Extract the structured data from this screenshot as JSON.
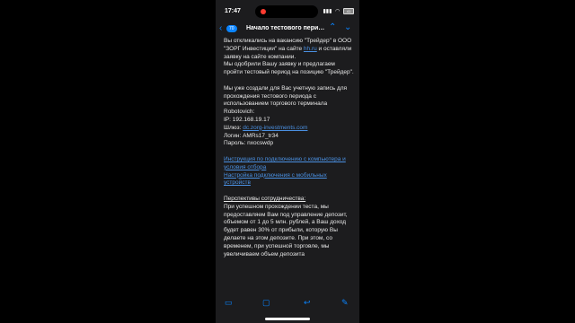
{
  "status": {
    "time": "17:47",
    "battery": "41"
  },
  "nav": {
    "back": "‹",
    "badge": "70",
    "title": "Начало тестового перио...",
    "up": "⌃",
    "down": "⌄"
  },
  "body": {
    "p1_a": "Вы откликались на вакансию \"Трейдер\" в ООО \"ЗОРГ Инвестиции\" на сайте ",
    "p1_link": "hh.ru",
    "p1_b": " и оставляли заявку на сайте компании.",
    "p1_c": "Мы одобрили Вашу заявку и предлагаем пройти тестовый период на позицию \"Трейдер\".",
    "p2": "Мы уже создали для Вас учетную запись для прохождения тестового периода с использованием торгового терминала Robotovich:",
    "ip": "IP: 192.168.19.17",
    "gateway_label": "Шлюз: ",
    "gateway_link": "dc.zorg-investments.com",
    "login": "Логин: AMRs17_tr34",
    "password": "Пароль: nxocswdp",
    "link1": "Инструкция по подключению с компьютера и условия отбора",
    "link2": "Настройка подключения с мобильных устройств",
    "perspectives_heading": "Перспективы сотрудничества:",
    "perspectives_text": "При успешном прохождении теста, мы предоставляем Вам под управление депозит, объемом от 1 до 5 млн. рублей, а Ваш доход будет равен 30% от прибыли, которую Вы делаете на этом депозите. При этом, со временем, при успешной торговле, мы увеличиваем объем депозита"
  },
  "toolbar": {
    "items": [
      "archive-icon",
      "folder-icon",
      "reply-icon",
      "compose-icon"
    ]
  }
}
